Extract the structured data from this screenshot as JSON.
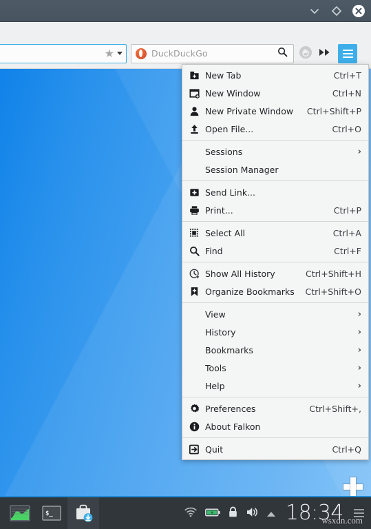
{
  "titlebar": {
    "controls": [
      {
        "name": "minimize",
        "glyph": "chevron-down-icon"
      },
      {
        "name": "maximize",
        "glyph": "diamond-icon"
      },
      {
        "name": "close",
        "glyph": "close-icon"
      }
    ]
  },
  "navbar": {
    "url_value": "",
    "url_placeholder": "",
    "bookmark_star": "★",
    "search_placeholder": "DuckDuckGo",
    "search_value": "",
    "search_engine": "DuckDuckGo",
    "adblock_label": "AdBlock",
    "fastforward_label": "▶▶",
    "menu_label": "Menu"
  },
  "menu": {
    "groups": [
      {
        "items": [
          {
            "icon": "new-tab-icon",
            "label": "New Tab",
            "shortcut": "Ctrl+T",
            "submenu": false,
            "indent": false
          },
          {
            "icon": "new-window-icon",
            "label": "New Window",
            "shortcut": "Ctrl+N",
            "submenu": false,
            "indent": false
          },
          {
            "icon": "new-private-window-icon",
            "label": "New Private Window",
            "shortcut": "Ctrl+Shift+P",
            "submenu": false,
            "indent": false
          },
          {
            "icon": "open-file-icon",
            "label": "Open File...",
            "shortcut": "Ctrl+O",
            "submenu": false,
            "indent": false
          }
        ]
      },
      {
        "items": [
          {
            "icon": "",
            "label": "Sessions",
            "shortcut": "",
            "submenu": true,
            "indent": true
          },
          {
            "icon": "",
            "label": "Session Manager",
            "shortcut": "",
            "submenu": false,
            "indent": true
          }
        ]
      },
      {
        "items": [
          {
            "icon": "send-link-icon",
            "label": "Send Link...",
            "shortcut": "",
            "submenu": false,
            "indent": false
          },
          {
            "icon": "print-icon",
            "label": "Print...",
            "shortcut": "Ctrl+P",
            "submenu": false,
            "indent": false
          }
        ]
      },
      {
        "items": [
          {
            "icon": "select-all-icon",
            "label": "Select All",
            "shortcut": "Ctrl+A",
            "submenu": false,
            "indent": false
          },
          {
            "icon": "find-icon",
            "label": "Find",
            "shortcut": "Ctrl+F",
            "submenu": false,
            "indent": false
          }
        ]
      },
      {
        "items": [
          {
            "icon": "history-icon",
            "label": "Show All History",
            "shortcut": "Ctrl+Shift+H",
            "submenu": false,
            "indent": false
          },
          {
            "icon": "bookmark-icon",
            "label": "Organize Bookmarks",
            "shortcut": "Ctrl+Shift+O",
            "submenu": false,
            "indent": false
          }
        ]
      },
      {
        "items": [
          {
            "icon": "",
            "label": "View",
            "shortcut": "",
            "submenu": true,
            "indent": true
          },
          {
            "icon": "",
            "label": "History",
            "shortcut": "",
            "submenu": true,
            "indent": true
          },
          {
            "icon": "",
            "label": "Bookmarks",
            "shortcut": "",
            "submenu": true,
            "indent": true
          },
          {
            "icon": "",
            "label": "Tools",
            "shortcut": "",
            "submenu": true,
            "indent": true
          },
          {
            "icon": "",
            "label": "Help",
            "shortcut": "",
            "submenu": true,
            "indent": true
          }
        ]
      },
      {
        "items": [
          {
            "icon": "preferences-icon",
            "label": "Preferences",
            "shortcut": "Ctrl+Shift+,",
            "submenu": false,
            "indent": false
          },
          {
            "icon": "about-icon",
            "label": "About Falkon",
            "shortcut": "",
            "submenu": false,
            "indent": false
          }
        ]
      },
      {
        "items": [
          {
            "icon": "quit-icon",
            "label": "Quit",
            "shortcut": "Ctrl+Q",
            "submenu": false,
            "indent": false
          }
        ]
      }
    ]
  },
  "desktop": {
    "plus_icon": "plus-icon"
  },
  "taskbar": {
    "tasks": [
      {
        "name": "system-monitor",
        "icon": "system-monitor-icon",
        "active": false
      },
      {
        "name": "terminal",
        "icon": "terminal-icon",
        "active": false
      },
      {
        "name": "software-store",
        "icon": "package-download-icon",
        "active": true
      }
    ],
    "tray": [
      {
        "name": "wifi",
        "icon": "wifi-icon"
      },
      {
        "name": "battery",
        "icon": "battery-icon"
      },
      {
        "name": "lock",
        "icon": "lock-icon"
      },
      {
        "name": "volume",
        "icon": "volume-icon"
      },
      {
        "name": "expand",
        "icon": "chevron-up-icon"
      }
    ],
    "clock": "18:34",
    "menu_label": "Tray menu"
  },
  "watermark": {
    "text": "wsxdn.com"
  },
  "colors": {
    "accent": "#3daee9",
    "titlebar": "#4b5863",
    "taskbar": "#31363b",
    "menu_bg": "#f4f5f5",
    "desktop_blue": "#49a3f0"
  }
}
